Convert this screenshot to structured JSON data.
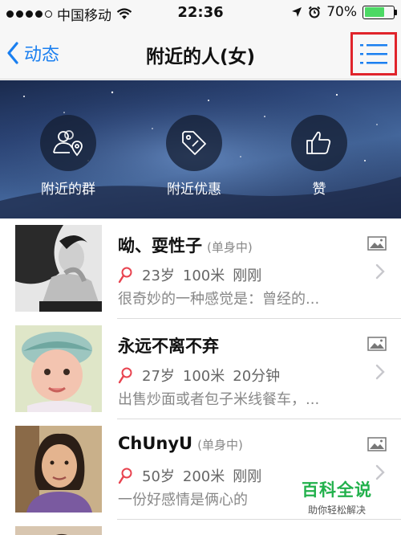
{
  "status_bar": {
    "carrier": "中国移动",
    "time": "22:36",
    "battery": "70%",
    "battery_level": 0.7
  },
  "nav": {
    "back_label": "动态",
    "title": "附近的人(女)"
  },
  "shortcuts": [
    {
      "label": "附近的群",
      "icon": "nearby-groups-icon"
    },
    {
      "label": "附近优惠",
      "icon": "discount-tag-icon"
    },
    {
      "label": "赞",
      "icon": "thumbs-up-icon"
    }
  ],
  "people": [
    {
      "name": "呦、耍性子",
      "relationship": "(单身中)",
      "age": "23岁",
      "distance": "100米",
      "time": "刚刚",
      "description": "很奇妙的一种感觉是：曾经的..."
    },
    {
      "name": "永远不离不弃",
      "relationship": "",
      "age": "27岁",
      "distance": "100米",
      "time": "20分钟",
      "description": "出售炒面或者包子米线餐车，..."
    },
    {
      "name": "ChUnyU",
      "relationship": "(单身中)",
      "age": "50岁",
      "distance": "200米",
      "time": "刚刚",
      "description": "一份好感情是俩心的"
    }
  ],
  "watermark": {
    "main": "百科全说",
    "sub": "助你轻松解决"
  },
  "colors": {
    "accent": "#1a7ff0",
    "highlight": "#e0242b",
    "female_pin": "#e8434f",
    "battery": "#4cd964"
  }
}
